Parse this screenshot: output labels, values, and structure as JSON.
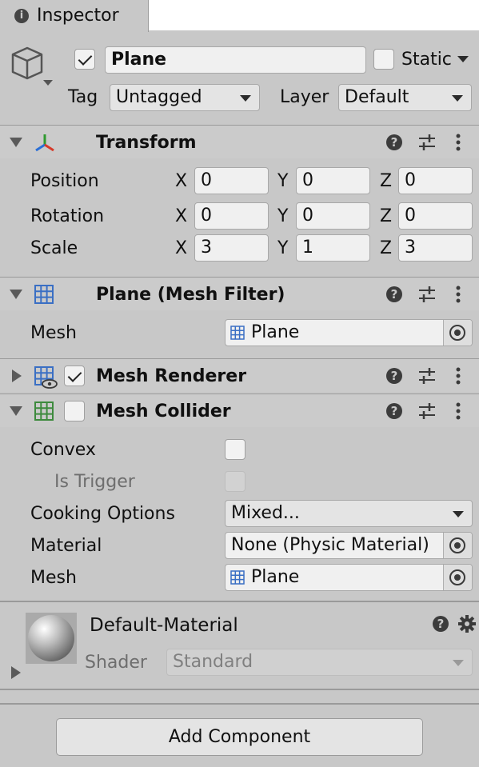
{
  "tab": {
    "title": "Inspector",
    "icon": "info-icon"
  },
  "object": {
    "active": true,
    "name": "Plane",
    "static_label": "Static",
    "tag_label": "Tag",
    "tag_value": "Untagged",
    "layer_label": "Layer",
    "layer_value": "Default"
  },
  "transform": {
    "title": "Transform",
    "rows": [
      {
        "label": "Position",
        "x": "0",
        "y": "0",
        "z": "0"
      },
      {
        "label": "Rotation",
        "x": "0",
        "y": "0",
        "z": "0"
      },
      {
        "label": "Scale",
        "x": "3",
        "y": "1",
        "z": "3"
      }
    ],
    "axes": {
      "x": "X",
      "y": "Y",
      "z": "Z"
    }
  },
  "mesh_filter": {
    "title": "Plane (Mesh Filter)",
    "mesh_label": "Mesh",
    "mesh_value": "Plane"
  },
  "mesh_renderer": {
    "title": "Mesh Renderer",
    "enabled": true
  },
  "mesh_collider": {
    "title": "Mesh Collider",
    "enabled": false,
    "convex_label": "Convex",
    "is_trigger_label": "Is Trigger",
    "cooking_label": "Cooking Options",
    "cooking_value": "Mixed...",
    "material_label": "Material",
    "material_value": "None (Physic Material)",
    "mesh_label": "Mesh",
    "mesh_value": "Plane"
  },
  "material": {
    "name": "Default-Material",
    "shader_label": "Shader",
    "shader_value": "Standard"
  },
  "add_component_label": "Add Component",
  "colors": {
    "panel_bg": "#c8c8c8",
    "field_bg": "#f0f0f0",
    "mesh_icon_blue": "#3a6fc4",
    "collider_icon_green": "#3d8a3d"
  }
}
